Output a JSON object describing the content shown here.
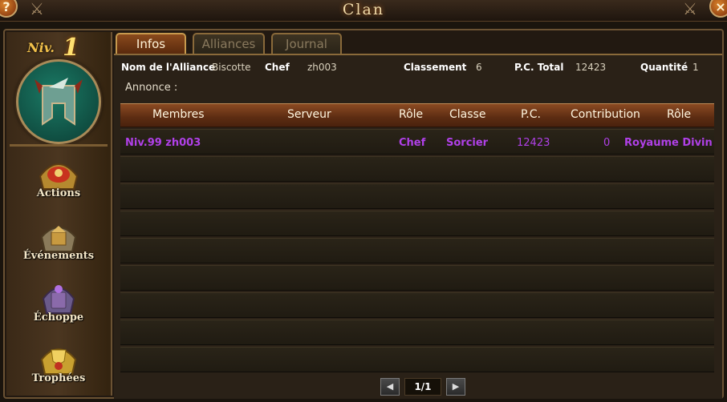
{
  "window": {
    "title": "Clan",
    "help_label": "?",
    "close_label": "×"
  },
  "sidebar": {
    "level_label": "Niv.",
    "level_value": "1",
    "items": [
      {
        "label": "Actions",
        "icon": "actions-icon"
      },
      {
        "label": "Événements",
        "icon": "events-icon"
      },
      {
        "label": "Échoppe",
        "icon": "shop-icon"
      },
      {
        "label": "Trophées",
        "icon": "trophies-icon"
      }
    ]
  },
  "tabs": [
    {
      "label": "Infos",
      "active": true
    },
    {
      "label": "Alliances",
      "active": false
    },
    {
      "label": "Journal",
      "active": false
    }
  ],
  "info": {
    "alliance_name_label": "Nom de l'Alliance",
    "alliance_name": "Biscotte",
    "chef_label": "Chef",
    "chef": "zh003",
    "rank_label": "Classement",
    "rank": "6",
    "pc_total_label": "P.C. Total",
    "pc_total": "12423",
    "quantity_label": "Quantité",
    "quantity": "1",
    "announce_label": "Annonce :"
  },
  "table": {
    "headers": [
      "Membres",
      "Serveur",
      "Rôle",
      "Classe",
      "P.C.",
      "Contribution",
      "Rôle"
    ],
    "rows": [
      {
        "member": "Niv.99  zh003",
        "server": "",
        "role": "Chef",
        "class": "Sorcier",
        "pc": "12423",
        "contribution": "0",
        "realm_role": "Royaume Divin"
      }
    ],
    "empty_rows": 8
  },
  "pagination": {
    "prev_label": "◀",
    "next_label": "▶",
    "page": "1/1"
  },
  "colors": {
    "member_text": "#b040e8",
    "header_bg": "#7a3c18",
    "accent_gold": "#f1c04a"
  }
}
